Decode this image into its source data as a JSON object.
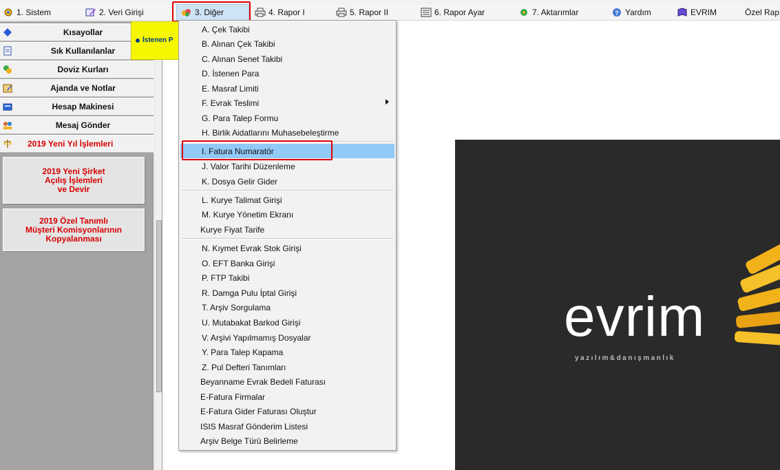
{
  "menubar": {
    "items": [
      {
        "label": "1.  Sistem",
        "icon": "system-icon"
      },
      {
        "label": "2.  Veri Girişi",
        "icon": "data-entry-icon"
      },
      {
        "label": "3.  Diğer",
        "icon": "other-icon"
      },
      {
        "label": "4.  Rapor I",
        "icon": "printer-icon"
      },
      {
        "label": "5.  Rapor II",
        "icon": "printer-icon"
      },
      {
        "label": "6.  Rapor Ayar",
        "icon": "report-settings-icon"
      },
      {
        "label": "7.  Aktarımlar",
        "icon": "transfer-icon"
      },
      {
        "label": "Yardım",
        "icon": "help-icon"
      },
      {
        "label": "EVRIM",
        "icon": "book-icon"
      },
      {
        "label": "Özel Rap",
        "icon": ""
      }
    ]
  },
  "left_panel": {
    "items": [
      {
        "label": "Kısayollar",
        "icon": "shortcuts-icon"
      },
      {
        "label": "Sık Kullanılanlar",
        "icon": "favorites-icon"
      },
      {
        "label": "Doviz Kurları",
        "icon": "currency-icon"
      },
      {
        "label": "Ajanda ve Notlar",
        "icon": "agenda-icon"
      },
      {
        "label": "Hesap Makinesi",
        "icon": "calculator-icon"
      },
      {
        "label": "Mesaj Gönder",
        "icon": "users-icon"
      },
      {
        "label": "2019 Yeni Yıl İşlemleri",
        "icon": "scales-icon"
      }
    ],
    "buttons": [
      {
        "line1": "2019 Yeni Şirket",
        "line2": "Açılış İşlemleri",
        "line3": "ve Devir"
      },
      {
        "line1": "2019 Özel Tanımlı",
        "line2": "Müşteri Komisyonlarının",
        "line3": "Kopyalanması"
      }
    ]
  },
  "tooltip": {
    "text": "İstenen P"
  },
  "dropdown": {
    "items": [
      {
        "label": "A.  Çek Takibi"
      },
      {
        "label": "B.  Alınan Çek Takibi"
      },
      {
        "label": "C.  Alınan Senet Takibi"
      },
      {
        "label": "D.  İstenen Para"
      },
      {
        "label": "E.  Masraf Limiti"
      },
      {
        "label": "F.  Evrak Teslimi"
      },
      {
        "label": "G.  Para Talep Formu"
      },
      {
        "label": "H.  Birlik Aidatlarını Muhasebeleştirme"
      },
      {
        "label": "I.  Fatura Numaratör"
      },
      {
        "label": "J.  Valor Tarihi Düzenleme"
      },
      {
        "label": "K.  Dosya Gelir Gider"
      },
      {
        "label": "L.  Kurye Talimat Girişi"
      },
      {
        "label": "M.  Kurye Yönetim Ekranı"
      },
      {
        "label": "Kurye Fiyat Tarife"
      },
      {
        "label": "N.  Kıymet Evrak Stok Girişi"
      },
      {
        "label": "O.  EFT Banka Girişi"
      },
      {
        "label": "P.  FTP Takibi"
      },
      {
        "label": "R.  Damga Pulu İptal  Girişi"
      },
      {
        "label": "T. Arşiv Sorgulama"
      },
      {
        "label": "U. Mutabakat Barkod Girişi"
      },
      {
        "label": "V. Arşivi Yapılmamış Dosyalar"
      },
      {
        "label": "Y.  Para Talep Kapama"
      },
      {
        "label": "Z. Pul Defteri Tanımları"
      },
      {
        "label": "Beyanname Evrak Bedeli Faturası"
      },
      {
        "label": "E-Fatura Firmalar"
      },
      {
        "label": "E-Fatura Gider Faturası Oluştur"
      },
      {
        "label": "ISIS Masraf Gönderim Listesi"
      },
      {
        "label": "Arşiv Belge Türü Belirleme"
      }
    ],
    "selected_index": 8
  },
  "logo": {
    "word": "evrim",
    "tagline": "yazılım&danışmanlık"
  },
  "colors": {
    "highlight_red": "#e00000",
    "menu_selected": "#91c9f7",
    "logo_bg": "#2a2a2a",
    "logo_accent": "#f2b21a"
  }
}
